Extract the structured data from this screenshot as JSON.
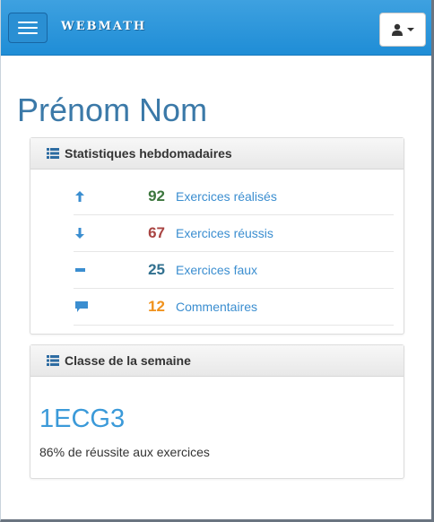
{
  "navbar": {
    "brand": "Webmath",
    "colors": {
      "bar": "#2196de",
      "button_bg": "#ffffff"
    },
    "menu_icon": "hamburger-icon",
    "user_icon": "user-icon"
  },
  "profile": {
    "name": "Prénom Nom"
  },
  "weekly_stats": {
    "title": "Statistiques hebdomadaires",
    "title_icon": "list-icon",
    "items": [
      {
        "icon": "arrow-up-icon",
        "value": "92",
        "label": "Exercices réalisés",
        "color": "#3c763d"
      },
      {
        "icon": "arrow-down-icon",
        "value": "67",
        "label": "Exercices réussis",
        "color": "#a94442"
      },
      {
        "icon": "minus-icon",
        "value": "25",
        "label": "Exercices faux",
        "color": "#31708f"
      },
      {
        "icon": "comment-icon",
        "value": "12",
        "label": "Commentaires",
        "color": "#f0921d"
      }
    ]
  },
  "class_week": {
    "title": "Classe de la semaine",
    "title_icon": "list-icon",
    "class_name": "1ECG3",
    "success_text": "86% de réussite aux exercices"
  }
}
